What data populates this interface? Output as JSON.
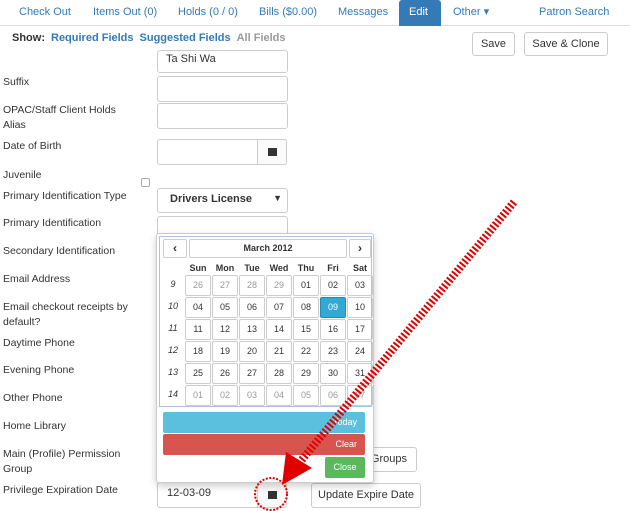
{
  "nav": {
    "tabs": [
      "Check Out",
      "Items Out (0)",
      "Holds (0 / 0)",
      "Bills ($0.00)",
      "Messages",
      "Edit",
      "Other ▾",
      "Patron Search"
    ],
    "active": "Edit"
  },
  "show": {
    "label": "Show:",
    "required": "Required Fields",
    "suggested": "Suggested Fields",
    "all": "All Fields"
  },
  "toolbar": {
    "save": "Save",
    "save_clone": "Save & Clone"
  },
  "form": {
    "top_value": "Ta Shi Wa",
    "labels": {
      "suffix": "Suffix",
      "opac": "OPAC/Staff Client Holds Alias",
      "dob": "Date of Birth",
      "juvenile": "Juvenile",
      "pit": "Primary Identification Type",
      "pi": "Primary Identification",
      "si": "Secondary Identification",
      "email": "Email Address",
      "email_receipts": "Email checkout receipts by default?",
      "daytime": "Daytime Phone",
      "evening": "Evening Phone",
      "other": "Other Phone",
      "home_library": "Home Library",
      "perm_group": "Main (Profile) Permission Group",
      "expire": "Privilege Expiration Date"
    },
    "pit_value": "Drivers License",
    "groups_button": "Groups",
    "expire_value": "12-03-09",
    "update_expire": "Update Expire Date"
  },
  "calendar": {
    "title": "March 2012",
    "prev": "‹",
    "next": "›",
    "day_names": [
      "Sun",
      "Mon",
      "Tue",
      "Wed",
      "Thu",
      "Fri",
      "Sat"
    ],
    "weeks": [
      {
        "num": "9",
        "days": [
          "26",
          "27",
          "28",
          "29",
          "01",
          "02",
          "03"
        ]
      },
      {
        "num": "10",
        "days": [
          "04",
          "05",
          "06",
          "07",
          "08",
          "09",
          "10"
        ]
      },
      {
        "num": "11",
        "days": [
          "11",
          "12",
          "13",
          "14",
          "15",
          "16",
          "17"
        ]
      },
      {
        "num": "12",
        "days": [
          "18",
          "19",
          "20",
          "21",
          "22",
          "23",
          "24"
        ]
      },
      {
        "num": "13",
        "days": [
          "25",
          "26",
          "27",
          "28",
          "29",
          "30",
          "31"
        ]
      },
      {
        "num": "14",
        "days": [
          "01",
          "02",
          "03",
          "04",
          "05",
          "06",
          "07"
        ]
      }
    ],
    "selected": "09",
    "today": "Today",
    "clear": "Clear",
    "close": "Close"
  },
  "colors": {
    "primary": "#337ab7",
    "info": "#5bc0de",
    "danger": "#d9534f",
    "success": "#5cb85c",
    "annotation": "#e00000"
  }
}
